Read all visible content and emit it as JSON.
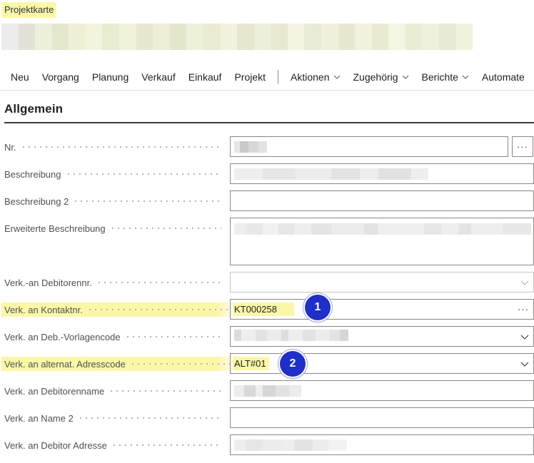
{
  "page": {
    "type_label": "Projektkarte"
  },
  "actions": {
    "neu": "Neu",
    "vorgang": "Vorgang",
    "planung": "Planung",
    "verkauf": "Verkauf",
    "einkauf": "Einkauf",
    "projekt": "Projekt",
    "aktionen": "Aktionen",
    "zugehoerig": "Zugehörig",
    "berichte": "Berichte",
    "automate": "Automate"
  },
  "section": {
    "title": "Allgemein"
  },
  "fields": {
    "nr": {
      "label": "Nr.",
      "more": "···"
    },
    "beschreibung": {
      "label": "Beschreibung"
    },
    "beschreibung2": {
      "label": "Beschreibung 2",
      "value": ""
    },
    "erweiterte": {
      "label": "Erweiterte Beschreibung"
    },
    "debitorennr": {
      "label": "Verk.-an Debitorennr.",
      "value": ""
    },
    "kontaktnr": {
      "label": "Verk. an Kontaktnr.",
      "value": "KT000258",
      "more": "···"
    },
    "vorlagencode": {
      "label": "Verk. an Deb.-Vorlagencode"
    },
    "adresscode": {
      "label": "Verk. an alternat. Adresscode",
      "value": "ALT#01"
    },
    "debitorenname": {
      "label": "Verk. an Debitorenname"
    },
    "name2": {
      "label": "Verk. an Name 2",
      "value": ""
    },
    "adresse": {
      "label": "Verk. an Debitor Adresse"
    }
  },
  "badges": {
    "one": "1",
    "two": "2"
  },
  "colors": {
    "highlight": "#fbf7a9",
    "badge": "#1f2fc8",
    "border": "#8a8886"
  },
  "icons": {
    "dropdown": "chevron-down-icon",
    "assist": "more-icon"
  }
}
